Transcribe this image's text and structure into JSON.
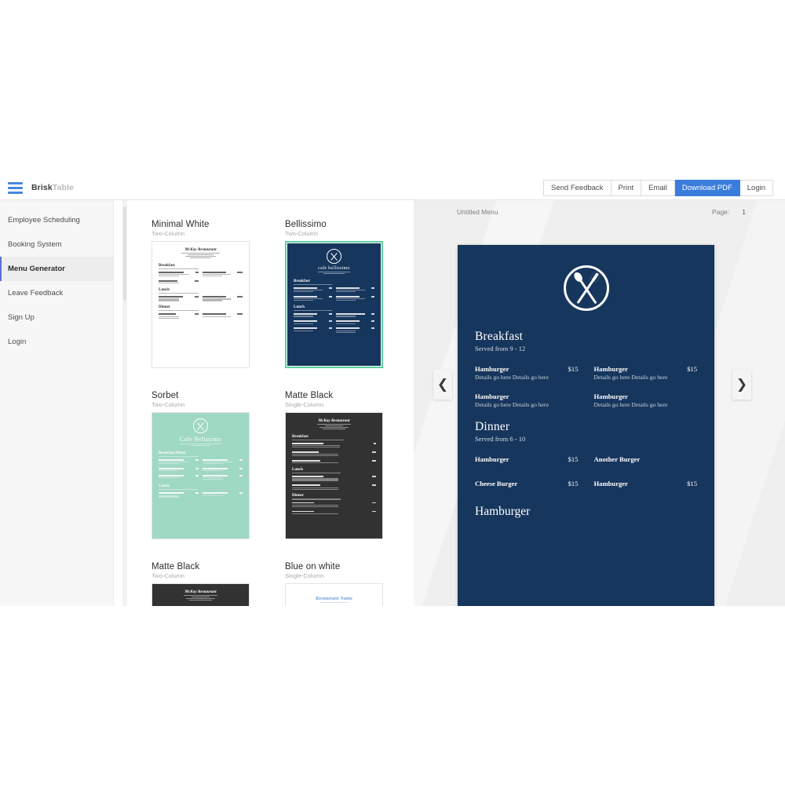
{
  "app": {
    "brand_primary": "Brisk",
    "brand_secondary": "Table",
    "accent_blue": "#3b7ddd",
    "selected_green": "#5ecfa0",
    "menu_navy": "#17365d"
  },
  "topbar": {
    "menu_icon": "hamburger-icon",
    "buttons": [
      {
        "label": "Send Feedback",
        "primary": false
      },
      {
        "label": "Print",
        "primary": false
      },
      {
        "label": "Email",
        "primary": false
      },
      {
        "label": "Download PDF",
        "primary": true
      },
      {
        "label": "Login",
        "primary": false
      }
    ]
  },
  "sidebar": {
    "items": [
      {
        "label": "Employee Scheduling",
        "active": false
      },
      {
        "label": "Booking System",
        "active": false
      },
      {
        "label": "Menu Generator",
        "active": true
      },
      {
        "label": "Leave Feedback",
        "active": false
      },
      {
        "label": "Sign Up",
        "active": false
      },
      {
        "label": "Login",
        "active": false
      }
    ]
  },
  "gallery": {
    "templates": [
      {
        "name": "Minimal White",
        "layout": "Two-Column",
        "style": "light",
        "selected": false,
        "restaurant": "McKay Restaurant"
      },
      {
        "name": "Bellissimo",
        "layout": "Two-Column",
        "style": "navy",
        "selected": true,
        "restaurant": "cafe bellissimo"
      },
      {
        "name": "Sorbet",
        "layout": "Two-Column",
        "style": "mint",
        "selected": false,
        "restaurant": "Cafe Belissimo"
      },
      {
        "name": "Matte Black",
        "layout": "Single-Column",
        "style": "dark",
        "selected": false,
        "restaurant": "McKay Restaurant"
      },
      {
        "name": "Matte Black",
        "layout": "Two-Column",
        "style": "dark",
        "selected": false,
        "restaurant": "McKay Restaurant"
      },
      {
        "name": "Blue on white",
        "layout": "Single-Column",
        "style": "light",
        "selected": false,
        "restaurant": "Restaurant Name"
      }
    ]
  },
  "preview": {
    "document_title": "Untitled Menu",
    "page_label": "Page:",
    "page_number": "1",
    "prev_arrow": "chevron-left-icon",
    "next_arrow": "chevron-right-icon",
    "logo_icon": "fork-and-spoon-circle-icon",
    "sections": [
      {
        "name": "Breakfast",
        "served": "Served from 9 - 12",
        "items": [
          {
            "name": "Hamburger",
            "price": "$15",
            "details": "Details go here Details go here"
          },
          {
            "name": "Hamburger",
            "price": "$15",
            "details": "Details go here Details go here"
          },
          {
            "name": "Hamburger",
            "price": "",
            "details": "Details go here Details go here"
          },
          {
            "name": "Hamburger",
            "price": "",
            "details": "Details go here Details go here"
          }
        ]
      },
      {
        "name": "Dinner",
        "served": "Served from 6 - 10",
        "items": [
          {
            "name": "Hamburger",
            "price": "$15",
            "details": ""
          },
          {
            "name": "Another Burger",
            "price": "",
            "details": ""
          },
          {
            "name": "Cheese Burger",
            "price": "$15",
            "details": ""
          },
          {
            "name": "Hamburger",
            "price": "$15",
            "details": ""
          }
        ]
      }
    ],
    "free_title": "Hamburger"
  }
}
